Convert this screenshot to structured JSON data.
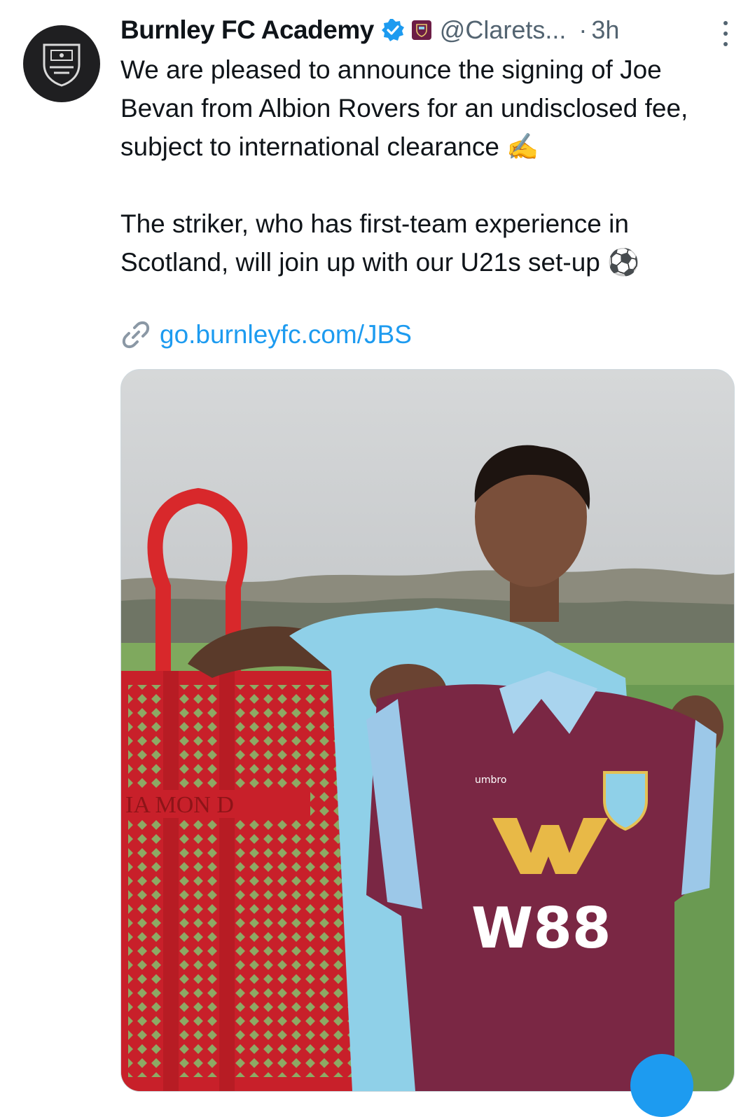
{
  "tweet": {
    "author_name": "Burnley FC Academy",
    "handle": "@Clarets...",
    "separator": "·",
    "time": "3h",
    "paragraph_1": "We are pleased to announce the signing of Joe Bevan from Albion Rovers for an undisclosed fee, subject to international clearance ✍️",
    "paragraph_2": "The striker, who has first-team experience in Scotland, will join up with our U21s set-up ⚽",
    "link_text": "go.burnleyfc.com/JBS",
    "icons": {
      "avatar": "club-crest-icon",
      "verified": "verified-badge-icon",
      "affiliate": "affiliate-badge-icon",
      "more": "more-options-icon",
      "link": "link-icon"
    }
  },
  "media": {
    "frame_text": "IA MON D",
    "shirt_brand": "umbro",
    "shirt_sponsor": "W88"
  },
  "colors": {
    "link": "#1d9bf0",
    "secondary_text": "#536471",
    "claret": "#6c1d45",
    "sky_blue": "#8fd0e8"
  }
}
